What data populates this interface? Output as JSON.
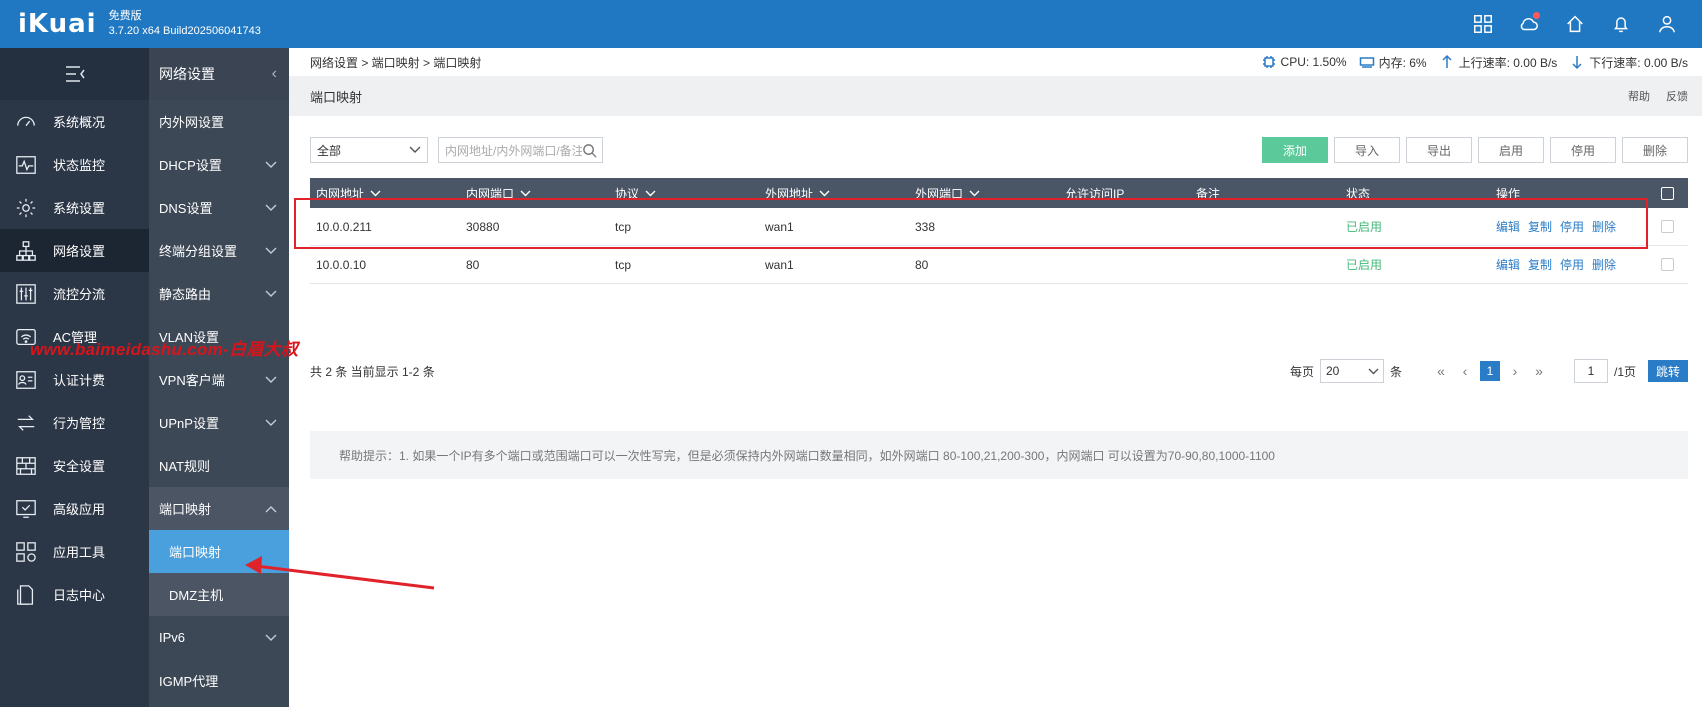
{
  "header": {
    "logo": "iKuai",
    "edition": "免费版",
    "version": "3.7.20 x64 Build202506041743"
  },
  "nav1": {
    "items": [
      {
        "label": "系统概况",
        "icon": "gauge-icon"
      },
      {
        "label": "状态监控",
        "icon": "monitor-pulse-icon"
      },
      {
        "label": "系统设置",
        "icon": "gear-icon"
      },
      {
        "label": "网络设置",
        "icon": "network-icon"
      },
      {
        "label": "流控分流",
        "icon": "sliders-icon"
      },
      {
        "label": "AC管理",
        "icon": "wifi-router-icon"
      },
      {
        "label": "认证计费",
        "icon": "id-card-icon"
      },
      {
        "label": "行为管控",
        "icon": "swap-arrows-icon"
      },
      {
        "label": "安全设置",
        "icon": "firewall-icon"
      },
      {
        "label": "高级应用",
        "icon": "check-screen-icon"
      },
      {
        "label": "应用工具",
        "icon": "apps-grid-icon"
      },
      {
        "label": "日志中心",
        "icon": "log-file-icon"
      }
    ]
  },
  "nav2": {
    "title": "网络设置",
    "items": [
      {
        "label": "内外网设置"
      },
      {
        "label": "DHCP设置"
      },
      {
        "label": "DNS设置"
      },
      {
        "label": "终端分组设置"
      },
      {
        "label": "静态路由"
      },
      {
        "label": "VLAN设置"
      },
      {
        "label": "VPN客户端"
      },
      {
        "label": "UPnP设置"
      },
      {
        "label": "NAT规则"
      },
      {
        "label": "端口映射"
      }
    ],
    "sub": [
      {
        "label": "端口映射"
      },
      {
        "label": "DMZ主机"
      }
    ],
    "after": [
      {
        "label": "IPv6"
      },
      {
        "label": "IGMP代理"
      }
    ]
  },
  "breadcrumb": "网络设置 > 端口映射 > 端口映射",
  "stats": {
    "cpu": "CPU: 1.50%",
    "mem": "内存: 6%",
    "up": "上行速率: 0.00 B/s",
    "down": "下行速率: 0.00 B/s"
  },
  "page_title": "端口映射",
  "title_links": {
    "help": "帮助",
    "feedback": "反馈"
  },
  "filter": {
    "selected": "全部",
    "search_placeholder": "内网地址/内外网端口/备注"
  },
  "actions": {
    "add": "添加",
    "import": "导入",
    "export": "导出",
    "enable": "启用",
    "disable": "停用",
    "delete": "删除"
  },
  "table": {
    "headers": [
      "内网地址",
      "内网端口",
      "协议",
      "外网地址",
      "外网端口",
      "允许访问IP",
      "备注",
      "状态",
      "操作"
    ],
    "rows": [
      {
        "lan_ip": "10.0.0.211",
        "lan_port": "30880",
        "proto": "tcp",
        "wan": "wan1",
        "wan_port": "338",
        "allow_ip": "",
        "note": "",
        "status": "已启用",
        "ops": [
          "编辑",
          "复制",
          "停用",
          "删除"
        ]
      },
      {
        "lan_ip": "10.0.0.10",
        "lan_port": "80",
        "proto": "tcp",
        "wan": "wan1",
        "wan_port": "80",
        "allow_ip": "",
        "note": "",
        "status": "已启用",
        "ops": [
          "编辑",
          "复制",
          "停用",
          "删除"
        ]
      }
    ]
  },
  "pager": {
    "summary": "共 2 条 当前显示 1-2 条",
    "per_page_label": "每页",
    "per_page": "20",
    "unit": "条",
    "current": "1",
    "page_input": "1",
    "total_pages": "/1页",
    "jump": "跳转"
  },
  "tip": "帮助提示：1. 如果一个IP有多个端口或范围端口可以一次性写完，但是必须保持内外网端口数量相同，如外网端口 80-100,21,200-300，内网端口 可以设置为70-90,80,1000-1100",
  "watermark": "www.baimeidashu.com-白眉大叔",
  "colors": {
    "topbar": "#2178c2",
    "nav1": "#2b3646",
    "nav2": "#3d4856",
    "accent": "#2a7cc7",
    "add": "#5cc99a",
    "enabled": "#46b97b",
    "annotation": "#e0232a"
  }
}
